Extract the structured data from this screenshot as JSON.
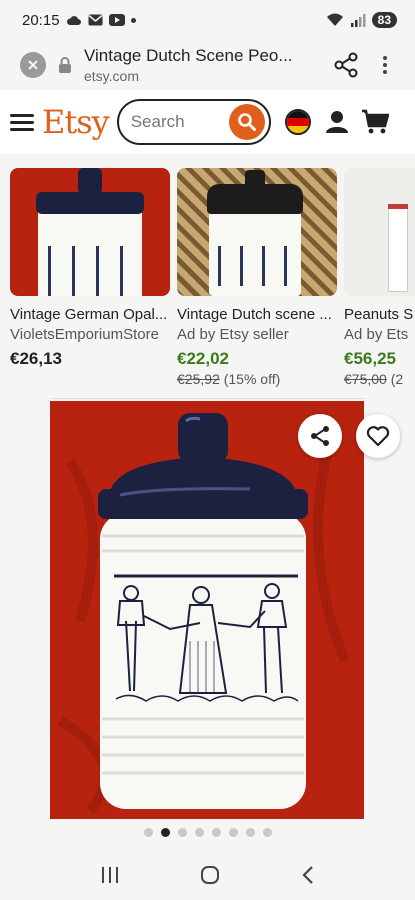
{
  "status": {
    "time": "20:15",
    "battery": "83"
  },
  "browser": {
    "page_title": "Vintage Dutch Scene Peo...",
    "domain": "etsy.com"
  },
  "header": {
    "logo": "Etsy",
    "search_placeholder": "Search"
  },
  "listings": [
    {
      "title": "Vintage German Opal...",
      "shop": "VioletsEmporiumStore",
      "price": "€26,13",
      "old_price": "",
      "discount": ""
    },
    {
      "title": "Vintage Dutch scene ...",
      "shop": "Ad by Etsy seller",
      "price": "€22,02",
      "old_price": "€25,92",
      "discount": "(15% off)"
    },
    {
      "title": "Peanuts S",
      "shop": "Ad by Ets",
      "price": "€56,25",
      "old_price": "€75,00",
      "discount": "(2"
    }
  ],
  "gallery": {
    "total_images": 8,
    "active_index": 1
  },
  "colors": {
    "accent": "#e0601b",
    "sale": "#3c7a1b",
    "lid": "#1c2140",
    "backdrop": "#b8230f"
  },
  "icons": [
    "cloud-icon",
    "mail-icon",
    "youtube-icon",
    "wifi-icon",
    "signal-icon",
    "close-icon",
    "lock-icon",
    "share-icon",
    "more-icon",
    "menu-icon",
    "search-icon",
    "flag-de-icon",
    "user-icon",
    "cart-icon",
    "heart-icon",
    "recents-icon",
    "home-icon",
    "back-icon"
  ]
}
